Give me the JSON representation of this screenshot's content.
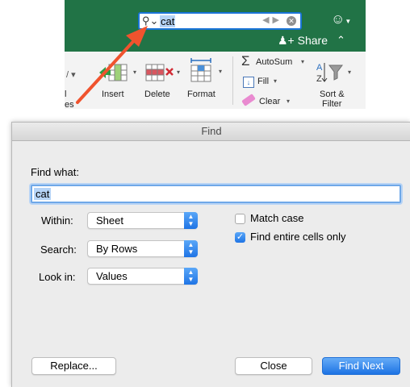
{
  "ribbon": {
    "search_value": "cat",
    "search_icon": "magnifier-icon",
    "share_label": "Share",
    "partial_label_1": "l",
    "partial_label_2": "es",
    "cells_group": [
      {
        "name": "insert",
        "label": "Insert"
      },
      {
        "name": "delete",
        "label": "Delete"
      },
      {
        "name": "format",
        "label": "Format"
      }
    ],
    "editing": {
      "autosum_label": "AutoSum",
      "fill_label": "Fill",
      "clear_label": "Clear",
      "sort_filter_line1": "Sort &",
      "sort_filter_line2": "Filter"
    },
    "accent_color": "#217346"
  },
  "dialog": {
    "title": "Find",
    "find_what_label": "Find what:",
    "find_value": "cat",
    "within_label": "Within:",
    "within_value": "Sheet",
    "search_label": "Search:",
    "search_value": "By Rows",
    "lookin_label": "Look in:",
    "lookin_value": "Values",
    "match_case_label": "Match case",
    "match_case_checked": false,
    "entire_cells_label": "Find entire cells only",
    "entire_cells_checked": true,
    "replace_label": "Replace...",
    "close_label": "Close",
    "find_next_label": "Find Next",
    "highlight_color": "#1f74e5"
  }
}
